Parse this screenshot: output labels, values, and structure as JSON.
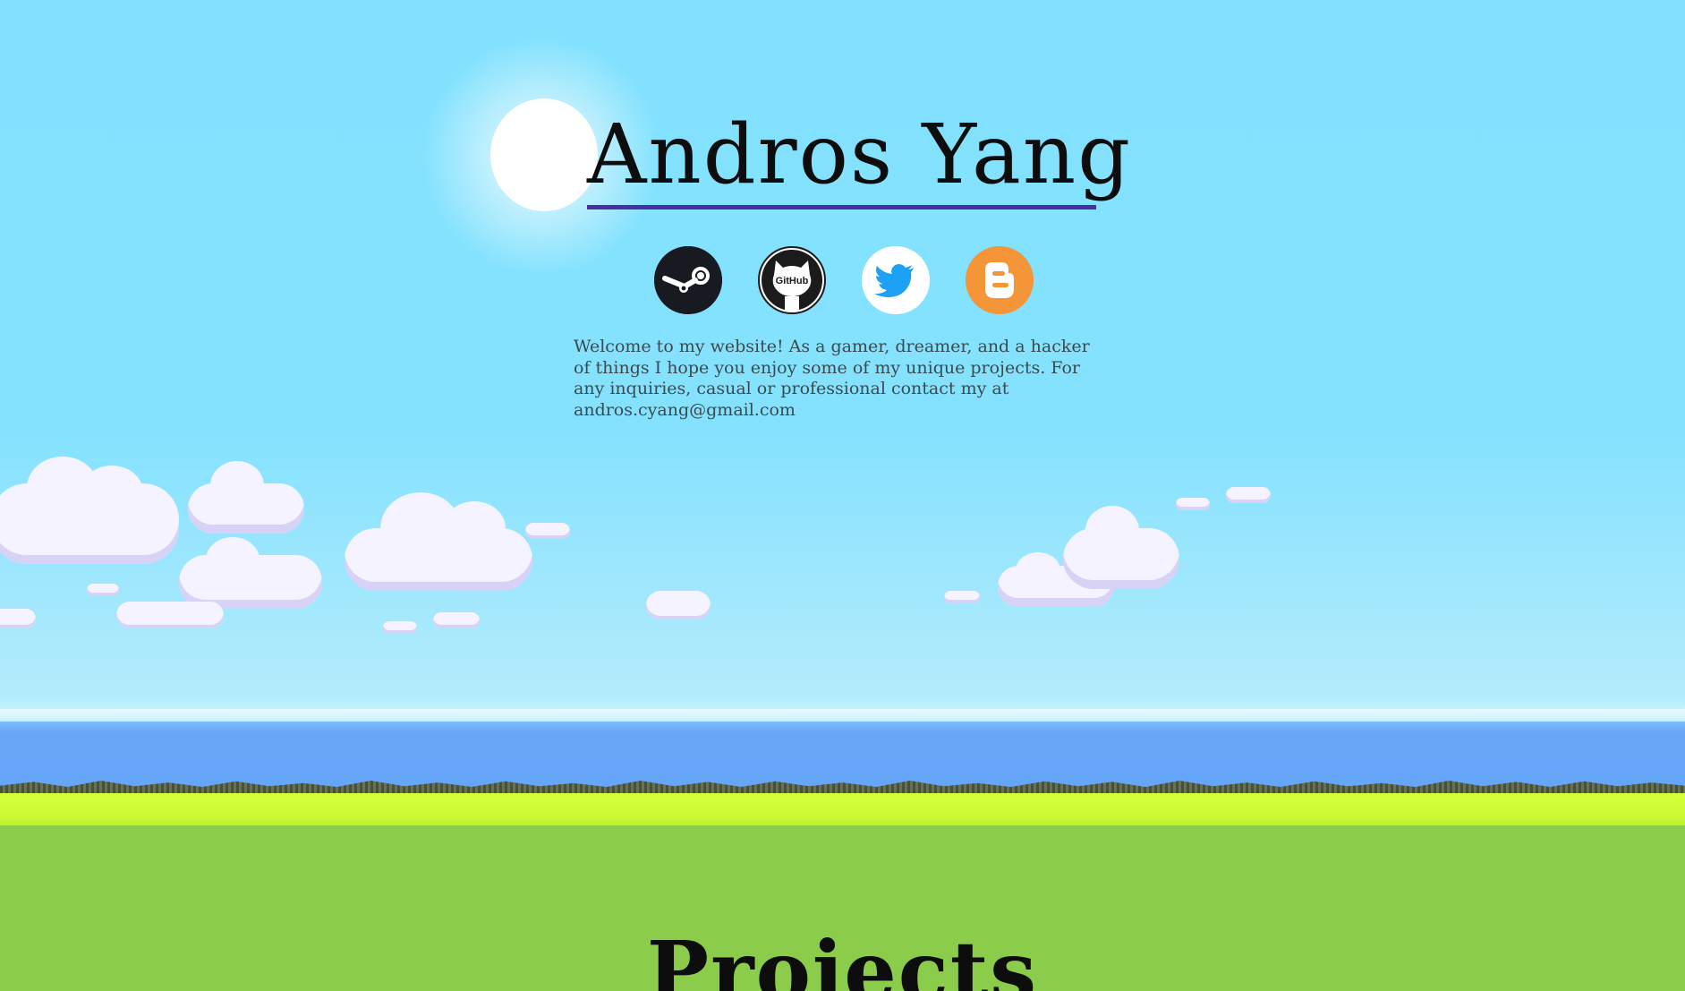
{
  "header": {
    "title": "Andros Yang",
    "accent_color": "#4b2ea2"
  },
  "socials": [
    {
      "name": "Steam",
      "icon": "steam-icon",
      "color": "#171a21"
    },
    {
      "name": "GitHub",
      "icon": "github-icon",
      "label": "GitHub",
      "color": "#ffffff"
    },
    {
      "name": "Twitter",
      "icon": "twitter-icon",
      "color": "#1da1f2"
    },
    {
      "name": "Blogger",
      "icon": "blogger-icon",
      "color": "#f49538"
    }
  ],
  "intro": {
    "text": "Welcome to my website! As a gamer, dreamer, and a hacker of things I hope you enjoy some of my unique projects. For any inquiries, casual or professional contact my at andros.cyang@gmail.com"
  },
  "sections": {
    "projects_heading": "Projects"
  },
  "scene": {
    "sky_color": "#82e1fe",
    "water_color": "#66a6f9",
    "grass_color": "#8ccc4b",
    "grass_highlight": "#d7ff3a"
  }
}
